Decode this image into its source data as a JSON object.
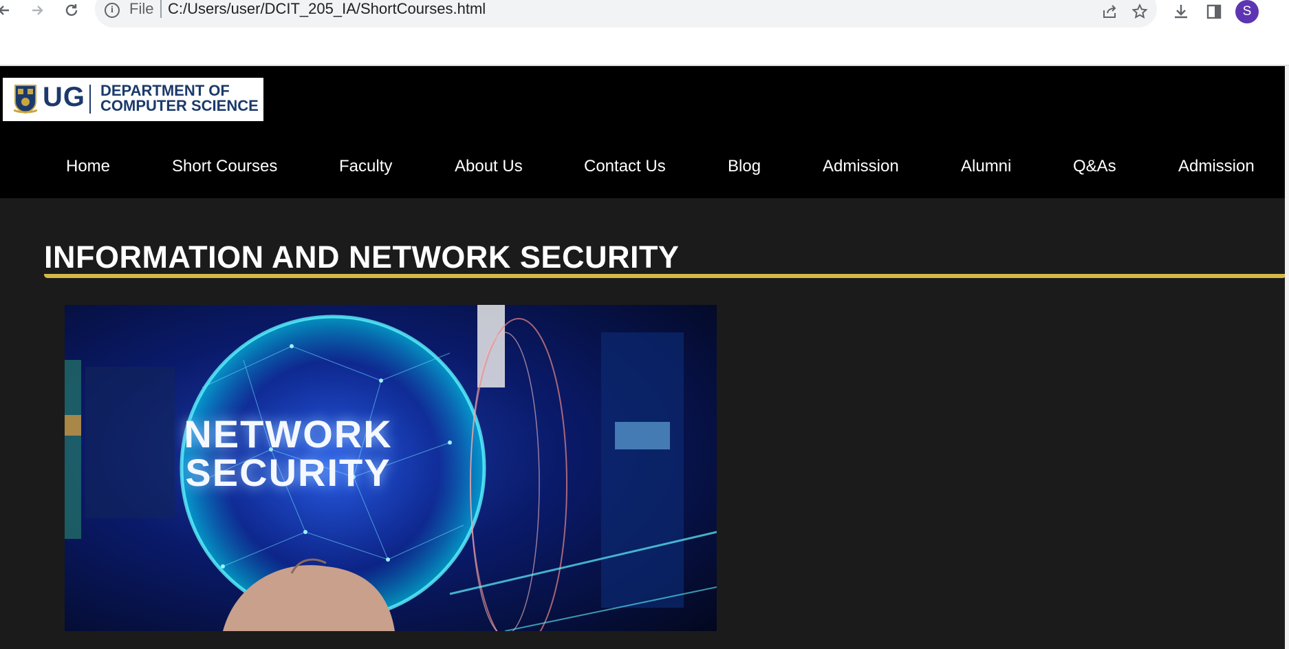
{
  "browser": {
    "url_scheme_label": "File",
    "url": "C:/Users/user/DCIT_205_IA/ShortCourses.html",
    "profile_initial": "S",
    "icons": [
      "back-icon",
      "forward-icon",
      "reload-icon",
      "info-icon",
      "share-icon",
      "star-icon",
      "download-icon",
      "side-panel-icon"
    ]
  },
  "site": {
    "logo": {
      "short": "UG",
      "line1": "DEPARTMENT OF",
      "line2": "COMPUTER SCIENCE"
    },
    "nav": [
      "Home",
      "Short Courses",
      "Faculty",
      "About Us",
      "Contact Us",
      "Blog",
      "Admission",
      "Alumni",
      "Q&As",
      "Admission"
    ]
  },
  "main": {
    "title": "INFORMATION AND NETWORK SECURITY",
    "hero_text_line1": "NETWORK",
    "hero_text_line2": "SECURITY"
  },
  "colors": {
    "header_bg": "#000000",
    "page_bg": "#1b1b1b",
    "accent_gold": "#d4b94a",
    "logo_blue": "#1b3a6b",
    "avatar": "#5e35b1"
  }
}
